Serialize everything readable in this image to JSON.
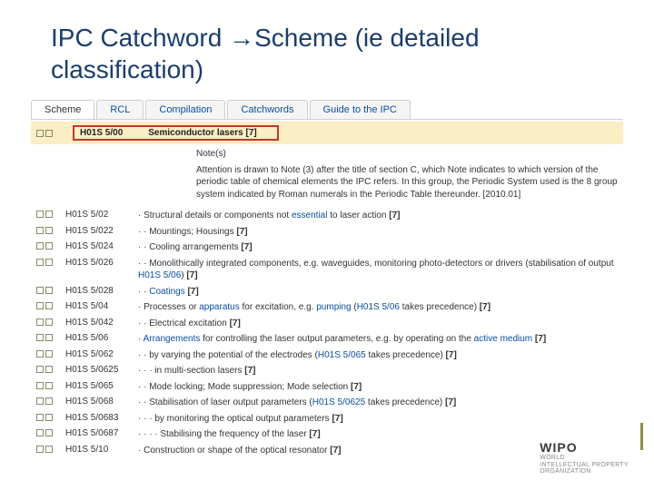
{
  "title": "IPC Catchword →Scheme (ie detailed classification)",
  "tabs": {
    "items": [
      {
        "label": "Scheme",
        "active": true
      },
      {
        "label": "RCL",
        "active": false
      },
      {
        "label": "Compilation",
        "active": false
      },
      {
        "label": "Catchwords",
        "active": false
      },
      {
        "label": "Guide to the IPC",
        "active": false
      }
    ]
  },
  "highlight": {
    "code": "H01S 5/00",
    "desc": "Semiconductor lasers [7]"
  },
  "note": {
    "title": "Note(s)",
    "body": "Attention is drawn to Note (3) after the title of section C, which Note indicates to which version of the periodic table of chemical elements the IPC refers. In this group, the Periodic System used is the 8 group system indicated by Roman numerals in the Periodic Table thereunder.  [2010.01]"
  },
  "rows": [
    {
      "code": "H01S 5/02",
      "desc": "· Structural details or components not essential to laser action [7]"
    },
    {
      "code": "H01S 5/022",
      "desc": "· · Mountings; Housings [7]"
    },
    {
      "code": "H01S 5/024",
      "desc": "· · Cooling arrangements [7]"
    },
    {
      "code": "H01S 5/026",
      "desc": "· · Monolithically integrated components, e.g. waveguides, monitoring photo-detectors or drivers (stabilisation of output H01S 5/06) [7]"
    },
    {
      "code": "H01S 5/028",
      "desc": "· · Coatings [7]"
    },
    {
      "code": "H01S 5/04",
      "desc": "· Processes or apparatus for excitation, e.g. pumping (H01S 5/06 takes precedence) [7]"
    },
    {
      "code": "H01S 5/042",
      "desc": "· · Electrical excitation [7]"
    },
    {
      "code": "H01S 5/06",
      "desc": "· Arrangements for controlling the laser output parameters, e.g. by operating on the active medium [7]"
    },
    {
      "code": "H01S 5/062",
      "desc": "· · by varying the potential of the electrodes (H01S 5/065 takes precedence) [7]"
    },
    {
      "code": "H01S 5/0625",
      "desc": "· · · in multi-section lasers [7]"
    },
    {
      "code": "H01S 5/065",
      "desc": "· · Mode locking; Mode suppression; Mode selection [7]"
    },
    {
      "code": "H01S 5/068",
      "desc": "· · Stabilisation of laser output parameters (H01S 5/0625 takes precedence) [7]"
    },
    {
      "code": "H01S 5/0683",
      "desc": "· · · by monitoring the optical output parameters [7]"
    },
    {
      "code": "H01S 5/0687",
      "desc": "· · · · Stabilising the frequency of the laser [7]"
    },
    {
      "code": "H01S 5/10",
      "desc": "· Construction or shape of the optical resonator [7]"
    }
  ],
  "branding": {
    "logo": "WIPO",
    "line1": "WORLD",
    "line2": "INTELLECTUAL PROPERTY",
    "line3": "ORGANIZATION"
  }
}
